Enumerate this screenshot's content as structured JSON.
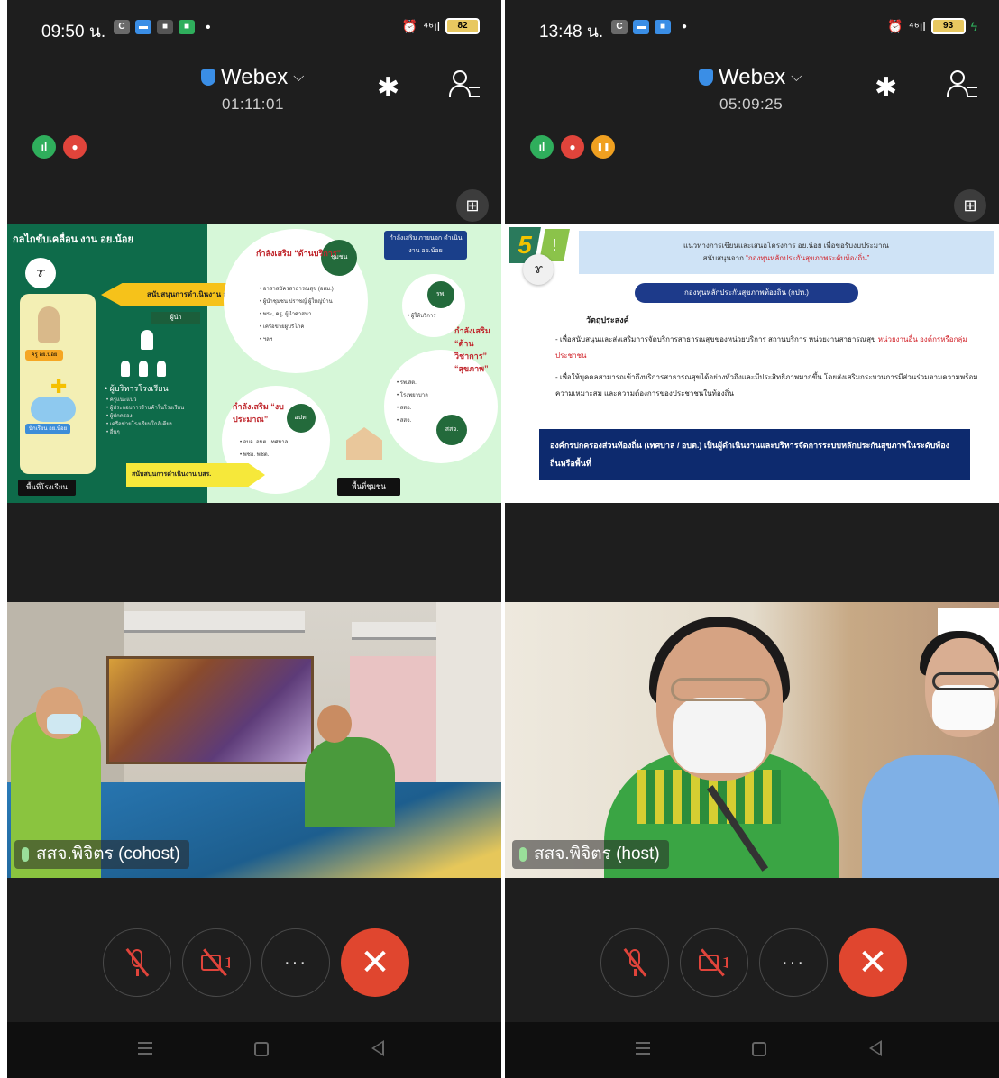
{
  "left": {
    "status": {
      "time": "09:50 น.",
      "apps": [
        {
          "icon": "app-icon-1",
          "color": "#e8e8e8",
          "glyph": "C"
        },
        {
          "icon": "app-icon-2",
          "color": "#3a8ee6",
          "glyph": "▬"
        },
        {
          "icon": "app-icon-3",
          "color": "#555555",
          "glyph": "■"
        },
        {
          "icon": "app-icon-4",
          "color": "#2fae5c",
          "glyph": "■"
        }
      ],
      "dot": "•",
      "alarm": "⏰",
      "signal": "⁴⁶ıl",
      "battery": "82"
    },
    "header": {
      "app_title": "Webex",
      "chevron": "⌵",
      "timer": "01:11:01",
      "bluetooth": "✱"
    },
    "indicators": [
      {
        "icon": "signal-indicator-icon",
        "glyph": "ıl",
        "color": "green"
      },
      {
        "icon": "mic-indicator-icon",
        "glyph": "●",
        "color": "red"
      }
    ],
    "layout_button": "⊞",
    "slide": {
      "header": "กลไกขับเคลื่อน งาน อย.น้อย",
      "scribble": "ɤ",
      "card_a": "ครู อย.น้อย",
      "card_b": "นักเรียน อย.น้อย",
      "plus": "✚",
      "arrow1": "สนับสนุนการดำเนินงาน อย.น้อย",
      "label_lead": "ผู้นำ",
      "school_label": "• ผู้บริหารโรงเรียน",
      "school_dots": [
        "• ครูแนะแนว",
        "• ผู้ประกอบการร้านค้าในโรงเรียน",
        "• ผู้ปกครอง",
        "• เครือข่ายโรงเรียนใกล้เคียง",
        "• อื่นๆ"
      ],
      "tag_bottom_left": "พื้นที่โรงเรียน",
      "arrow2": "สนับสนุนการดำเนินงาน บสร.",
      "topright_tag": "กำลังเสริม ภายนอก ดำเนินงาน อย.น้อย",
      "dark1": "ชุมชน",
      "dark2": "รพ.",
      "dark3": "อปท.",
      "dark4": "สสจ.",
      "red1": "กำลังเสริม “ด้านบริการ”",
      "red2": "กำลังเสริม “ด้านวิชาการ” “สุขภาพ”",
      "red3": "กำลังเสริม “งบประมาณ”",
      "bullets1": [
        "• อาสาสมัครสาธารณสุข (อสม.)",
        "• ผู้นำชุมชน ปราชญ์ ผู้ใหญ่บ้าน",
        "• พระ, ครู, ผู้นำศาสนา",
        "• เครือข่ายผู้บริโภค",
        "• ฯลฯ"
      ],
      "bullets2": [
        "• ผู้ให้บริการ"
      ],
      "bullets3": [
        "• อบจ. อบต. เทศบาล",
        "• พชอ. พชต."
      ],
      "bullets4": [
        "• รพ.สต.",
        "• โรงพยาบาล",
        "• สสอ.",
        "• สสจ."
      ],
      "tag_bottom_right": "พื้นที่ชุมชน"
    },
    "video": {
      "name": "สสจ.พิจิตร (cohost)"
    },
    "controls": {
      "more": "···",
      "end": "✕"
    }
  },
  "right": {
    "status": {
      "time": "13:48 น.",
      "apps": [
        {
          "icon": "app-icon-1",
          "color": "#e8e8e8",
          "glyph": "C"
        },
        {
          "icon": "app-icon-2",
          "color": "#3a8ee6",
          "glyph": "▬"
        },
        {
          "icon": "app-icon-3",
          "color": "#3a8ee6",
          "glyph": "■"
        },
        {
          "icon": "app-icon-4",
          "color": "#ffffff",
          "glyph": "●"
        }
      ],
      "dot": "",
      "alarm": "⏰",
      "signal": "⁴⁶ıl",
      "battery": "93"
    },
    "header": {
      "app_title": "Webex",
      "chevron": "⌵",
      "timer": "05:09:25",
      "bluetooth": "✱"
    },
    "indicators": [
      {
        "icon": "signal-indicator-icon",
        "glyph": "ıl",
        "color": "green"
      },
      {
        "icon": "mic-indicator-icon",
        "glyph": "●",
        "color": "red"
      },
      {
        "icon": "pause-indicator-icon",
        "glyph": "❚❚",
        "color": "orange"
      }
    ],
    "layout_button": "⊞",
    "slide": {
      "num": "5",
      "num2": "!",
      "scribble": "ɤ",
      "header_line1": "แนวทางการเขียนและเสนอโครงการ อย.น้อย เพื่อขอรับงบประมาณ",
      "header_line2_black": "สนับสนุนจาก",
      "header_line2_red": "“กองทุนหลักประกันสุขภาพระดับท้องถิ่น”",
      "pill": "กองทุนหลักประกันสุขภาพท้องถิ่น (กปท.)",
      "heading": "วัตถุประสงค์",
      "p1_a": "- เพื่อสนับสนุนและส่งเสริมการจัดบริการสาธารณสุขของหน่วยบริการ สถานบริการ หน่วยงานสาธารณสุข",
      "p1_red": "หน่วยงานอื่น องค์กรหรือกลุ่มประชาชน",
      "p2": "- เพื่อให้บุคคลสามารถเข้าถึงบริการสาธารณสุขได้อย่างทั่วถึงและมีประสิทธิภาพมากขึ้น โดยส่งเสริมกระบวนการมีส่วนร่วมตามความพร้อม ความเหมาะสม และความต้องการของประชาชนในท้องถิ่น",
      "box": "องค์กรปกครองส่วนท้องถิ่น (เทศบาล / อบต.) เป็นผู้ดำเนินงานและบริหารจัดการระบบหลักประกันสุขภาพในระดับท้องถิ่นหรือพื้นที่"
    },
    "video": {
      "name": "สสจ.พิจิตร (host)"
    },
    "controls": {
      "more": "···",
      "end": "✕"
    }
  }
}
